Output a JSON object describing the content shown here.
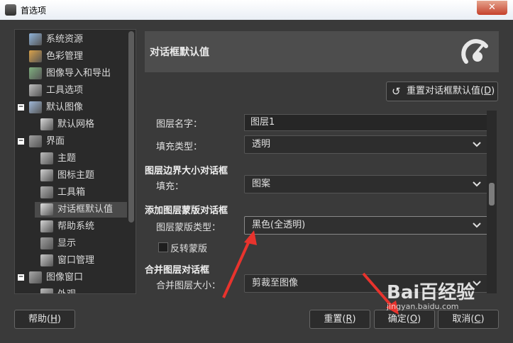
{
  "window": {
    "title": "首选项",
    "close_glyph": "✕"
  },
  "sidebar": {
    "items": [
      {
        "label": "系统资源",
        "icon": "chip-icon",
        "indent": 1
      },
      {
        "label": "色彩管理",
        "icon": "color-icon",
        "indent": 1
      },
      {
        "label": "图像导入和导出",
        "icon": "import-export-icon",
        "indent": 1
      },
      {
        "label": "工具选项",
        "icon": "tool-options-icon",
        "indent": 1
      },
      {
        "label": "默认图像",
        "icon": "default-image-icon",
        "indent": 1,
        "expander": "−"
      },
      {
        "label": "默认网格",
        "icon": "grid-icon",
        "indent": 2
      },
      {
        "label": "界面",
        "icon": "interface-icon",
        "indent": 1,
        "expander": "−"
      },
      {
        "label": "主题",
        "icon": "theme-icon",
        "indent": 2
      },
      {
        "label": "图标主题",
        "icon": "icon-theme-icon",
        "indent": 2
      },
      {
        "label": "工具箱",
        "icon": "toolbox-icon",
        "indent": 2
      },
      {
        "label": "对话框默认值",
        "icon": "dialog-defaults-icon",
        "indent": 2,
        "selected": true
      },
      {
        "label": "帮助系统",
        "icon": "help-system-icon",
        "indent": 2
      },
      {
        "label": "显示",
        "icon": "display-icon",
        "indent": 2
      },
      {
        "label": "窗口管理",
        "icon": "window-manage-icon",
        "indent": 2
      },
      {
        "label": "图像窗口",
        "icon": "image-window-icon",
        "indent": 1,
        "expander": "−"
      },
      {
        "label": "外观",
        "icon": "appearance-icon",
        "indent": 2
      }
    ]
  },
  "header": {
    "title": "对话框默认值",
    "icon": "gimp-dialog-icon"
  },
  "reset_defaults_button": {
    "label": "重置对话框默认值(",
    "mnemonic": "D",
    "suffix": ")"
  },
  "content": {
    "layer_name_label": "图层名字：",
    "layer_name_value": "图层1",
    "fill_type_label": "填充类型：",
    "fill_type_value": "透明",
    "layer_boundary_section": "图层边界大小对话框",
    "fill_label": "填充：",
    "fill_value": "图案",
    "add_mask_section": "添加图层蒙版对话框",
    "mask_type_label": "图层蒙版类型：",
    "mask_type_value": "黑色(全透明)",
    "invert_mask_label": "反转蒙版",
    "merge_section": "合并图层对话框",
    "merge_size_label": "合并图层大小：",
    "merge_size_value": "剪裁至图像"
  },
  "buttons": {
    "help": {
      "label": "帮助(",
      "mnemonic": "H",
      "suffix": ")"
    },
    "reset": {
      "label": "重置(",
      "mnemonic": "R",
      "suffix": ")"
    },
    "ok": {
      "label": "确定(",
      "mnemonic": "O",
      "suffix": ")"
    },
    "cancel": {
      "label": "取消(",
      "mnemonic": "C",
      "suffix": ")"
    }
  },
  "watermark": {
    "logo": "Bai百经验",
    "sub": "jingyan.baidu.com"
  },
  "colors": {
    "arrow": "#e8332d",
    "accent": "#ffffff"
  }
}
